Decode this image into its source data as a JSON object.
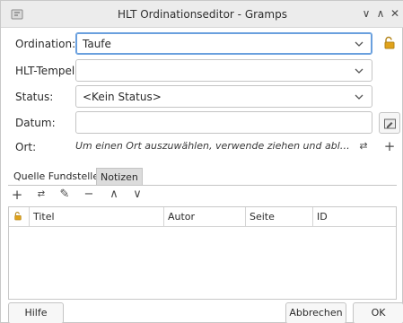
{
  "window": {
    "title": "HLT Ordinationseditor - Gramps",
    "minimize_glyph": "∨",
    "maximize_glyph": "∧",
    "close_glyph": "✕"
  },
  "form": {
    "ordination_label": "Ordination:",
    "ordination_value": "Taufe",
    "temple_label": "HLT-Tempel:",
    "temple_value": "",
    "status_label": "Status:",
    "status_value": "<Kein Status>",
    "date_label": "Datum:",
    "date_value": "",
    "place_label": "Ort:",
    "place_hint": "Um einen Ort auszuwählen, verwende ziehen und ablegen oder die…"
  },
  "tabs": [
    {
      "label": "Quelle Fundstellen",
      "active": true
    },
    {
      "label": "Notizen",
      "active": false
    }
  ],
  "toolbar": {
    "add": "+",
    "share": "⇄",
    "edit": "✎",
    "remove": "−",
    "up": "∧",
    "down": "∨"
  },
  "table": {
    "columns": [
      "Titel",
      "Autor",
      "Seite",
      "ID"
    ],
    "rows": []
  },
  "buttons": {
    "help": "Hilfe",
    "cancel": "Abbrechen",
    "ok": "OK"
  },
  "colors": {
    "focus": "#6aa0de",
    "lock": "#e0a21a"
  }
}
